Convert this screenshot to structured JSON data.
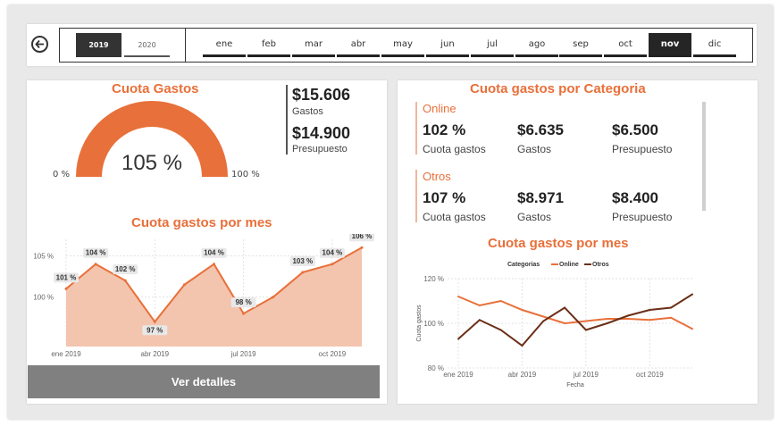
{
  "slicer": {
    "years": [
      "2019",
      "2020"
    ],
    "selected_year": "2019",
    "months": [
      "ene",
      "feb",
      "mar",
      "abr",
      "may",
      "jun",
      "jul",
      "ago",
      "sep",
      "oct",
      "nov",
      "dic"
    ],
    "selected_month": "nov"
  },
  "gauge": {
    "title": "Cuota Gastos",
    "value_label": "105 %",
    "value_pct": 105,
    "min_label": "0 %",
    "max_label": "100 %"
  },
  "kpis": {
    "gastos_value": "$15.606",
    "gastos_label": "Gastos",
    "presupuesto_value": "$14.900",
    "presupuesto_label": "Presupuesto"
  },
  "left_chart": {
    "title": "Cuota gastos por mes"
  },
  "button": {
    "label": "Ver detalles"
  },
  "categories": {
    "title": "Cuota gastos por Categoria",
    "rows": [
      {
        "name": "Online",
        "cuota": "102 %",
        "cuota_label": "Cuota gastos",
        "gastos": "$6.635",
        "gastos_label": "Gastos",
        "presupuesto": "$6.500",
        "presupuesto_label": "Presupuesto"
      },
      {
        "name": "Otros",
        "cuota": "107 %",
        "cuota_label": "Cuota gastos",
        "gastos": "$8.971",
        "gastos_label": "Gastos",
        "presupuesto": "$8.400",
        "presupuesto_label": "Presupuesto"
      }
    ]
  },
  "right_chart": {
    "title": "Cuota gastos por mes"
  },
  "colors": {
    "accent": "#e8703a",
    "online": "#e8703a",
    "otros": "#6b2e16",
    "area": "#f3c4ae"
  },
  "chart_data": [
    {
      "type": "area",
      "title": "Cuota gastos por mes",
      "x": [
        "ene 2019",
        "feb 2019",
        "mar 2019",
        "abr 2019",
        "may 2019",
        "jun 2019",
        "jul 2019",
        "ago 2019",
        "sep 2019",
        "oct 2019",
        "nov 2019"
      ],
      "x_ticks": [
        "ene 2019",
        "abr 2019",
        "jul 2019",
        "oct 2019"
      ],
      "y_ticks": [
        "100 %",
        "105 %"
      ],
      "series": [
        {
          "values": [
            101,
            104,
            102,
            97,
            101.5,
            104,
            98,
            100,
            103,
            104,
            106
          ]
        }
      ],
      "data_labels": [
        {
          "x": "ene 2019",
          "label": "101 %"
        },
        {
          "x": "feb 2019",
          "label": "104 %"
        },
        {
          "x": "mar 2019",
          "label": "102 %"
        },
        {
          "x": "abr 2019",
          "label": "97 %"
        },
        {
          "x": "jun 2019",
          "label": "104 %"
        },
        {
          "x": "jul 2019",
          "label": "98 %"
        },
        {
          "x": "sep 2019",
          "label": "103 %"
        },
        {
          "x": "oct 2019",
          "label": "104 %"
        },
        {
          "x": "nov 2019",
          "label": "106 %"
        }
      ],
      "ylim": [
        94,
        107
      ],
      "grid": true
    },
    {
      "type": "line",
      "title": "Cuota gastos por mes",
      "legend_title": "Categorias",
      "legend_position": "top",
      "xlabel": "Fecha",
      "ylabel": "Cuota gastos",
      "x": [
        "ene 2019",
        "feb 2019",
        "mar 2019",
        "abr 2019",
        "may 2019",
        "jun 2019",
        "jul 2019",
        "ago 2019",
        "sep 2019",
        "oct 2019",
        "nov 2019",
        "dic 2019"
      ],
      "x_ticks": [
        "ene 2019",
        "abr 2019",
        "jul 2019",
        "oct 2019"
      ],
      "y_ticks": [
        "80 %",
        "100 %",
        "120 %"
      ],
      "series": [
        {
          "name": "Online",
          "values": [
            112,
            108,
            110,
            106,
            103,
            100,
            101,
            102,
            102,
            101.5,
            102.5,
            97.5
          ]
        },
        {
          "name": "Otros",
          "values": [
            93,
            101.5,
            97,
            90,
            101,
            107,
            97,
            100,
            103.5,
            106,
            107,
            113
          ]
        }
      ],
      "ylim": [
        80,
        120
      ],
      "grid": true
    }
  ]
}
